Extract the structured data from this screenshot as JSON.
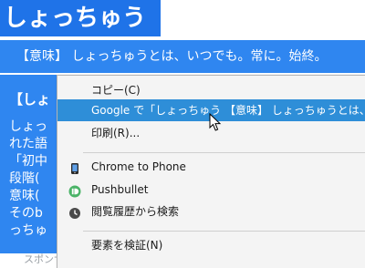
{
  "page": {
    "title": "しょっちゅう",
    "meaning": "【意味】 しょっちゅうとは、いつでも。常に。始終。",
    "section_heading": "【しょ",
    "body_lines": [
      "しょっ",
      "れた語",
      "「初中",
      "段階(",
      "意味(",
      "そのb",
      "っちゅ"
    ],
    "sponsor_text": "スポンサードリンク"
  },
  "context_menu": {
    "items": [
      {
        "label": "コピー(C)"
      },
      {
        "label": "Google で「しょっちゅう 【意味】 しょっちゅうとは、",
        "highlighted": true
      },
      {
        "label": "印刷(R)..."
      },
      {
        "label": "Chrome to Phone",
        "icon": "phone-icon"
      },
      {
        "label": "Pushbullet",
        "icon": "pushbullet-icon"
      },
      {
        "label": "閲覧履歴から検索",
        "icon": "history-clock-icon"
      },
      {
        "label": "要素を検証(N)"
      }
    ]
  },
  "colors": {
    "title_bg": "#1f73e8",
    "content_bg": "#2f86f0",
    "menu_bg": "#f4f4f4",
    "menu_highlight": "#2e8ed8"
  }
}
